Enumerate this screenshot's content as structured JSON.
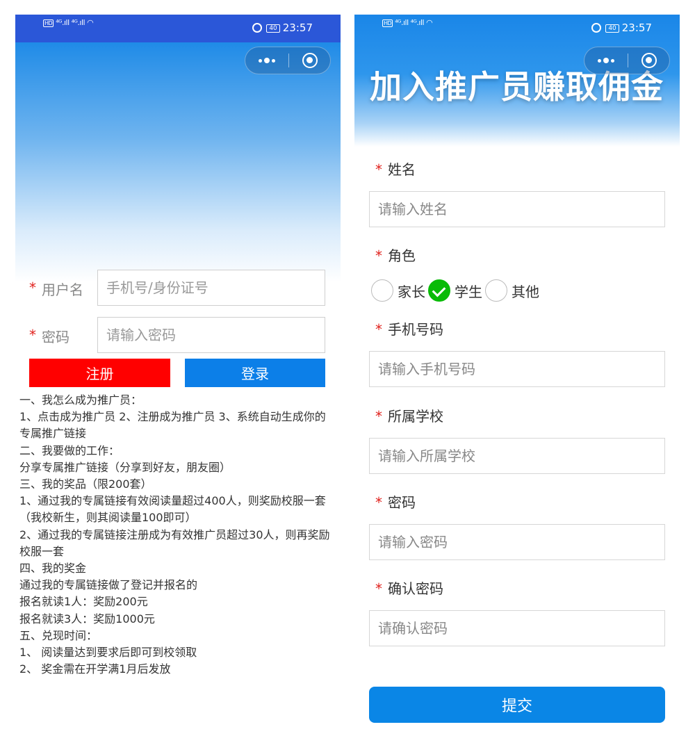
{
  "status_bar": {
    "network": "⁴ᴳ.ıll ⁴ᴳ.ıll",
    "hd": "HD",
    "battery": "40",
    "time": "23:57"
  },
  "login_page": {
    "username": {
      "label": "用户名",
      "placeholder": "手机号/身份证号"
    },
    "password": {
      "label": "密码",
      "placeholder": "请输入密码"
    },
    "register_button": "注册",
    "login_button": "登录",
    "rules": [
      "一、我怎么成为推广员：",
      "1、点击成为推广员 2、注册成为推广员 3、系统自动生成你的专属推广链接",
      "二、我要做的工作：",
      "分享专属推广链接（分享到好友，朋友圈）",
      "三、我的奖品（限200套）",
      "1、通过我的专属链接有效阅读量超过400人，则奖励校服一套 （我校新生，则其阅读量100即可）",
      "2、通过我的专属链接注册成为有效推广员超过30人，则再奖励校服一套",
      "四、我的奖金",
      "通过我的专属链接做了登记并报名的",
      "报名就读1人：奖励200元",
      "报名就读3人：奖励1000元",
      "五、兑现时间：",
      "1、 阅读量达到要求后即可到校领取",
      "2、 奖金需在开学满1月后发放"
    ]
  },
  "register_page": {
    "banner_title": "加入推广员赚取佣金",
    "name": {
      "label": "姓名",
      "placeholder": "请输入姓名"
    },
    "role": {
      "label": "角色",
      "options": [
        "家长",
        "学生",
        "其他"
      ],
      "selected": "学生"
    },
    "phone": {
      "label": "手机号码",
      "placeholder": "请输入手机号码"
    },
    "school": {
      "label": "所属学校",
      "placeholder": "请输入所属学校"
    },
    "password": {
      "label": "密码",
      "placeholder": "请输入密码"
    },
    "confirm_password": {
      "label": "确认密码",
      "placeholder": "请确认密码"
    },
    "submit_button": "提交"
  },
  "icons": [
    "more-dots-icon",
    "close-target-icon",
    "alarm-icon",
    "battery-icon",
    "signal-icon",
    "wifi-icon",
    "checkmark-icon"
  ],
  "colors": {
    "status_bar_left": "#2b57d8",
    "header_blue": "#1a86e8",
    "register_red": "#ff0000",
    "login_blue": "#0c7fe8",
    "required_star": "#e0211d",
    "radio_checked": "#09bb07",
    "submit_blue": "#0a86e6"
  }
}
